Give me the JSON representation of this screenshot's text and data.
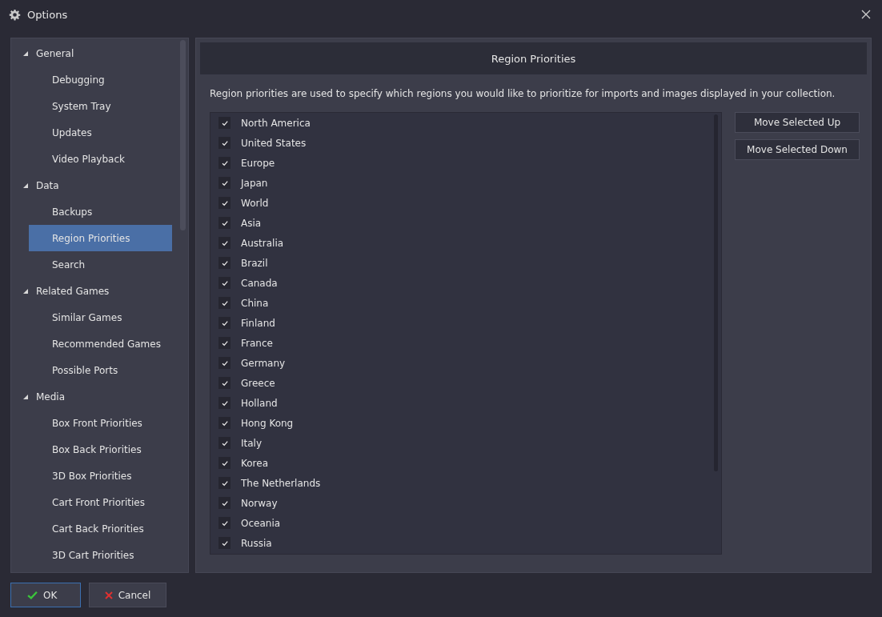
{
  "window": {
    "title": "Options"
  },
  "sidebar": {
    "items": [
      {
        "label": "General",
        "expanded": true,
        "selected": false,
        "children": [
          {
            "label": "Debugging",
            "selected": false
          },
          {
            "label": "System Tray",
            "selected": false
          },
          {
            "label": "Updates",
            "selected": false
          },
          {
            "label": "Video Playback",
            "selected": false
          }
        ]
      },
      {
        "label": "Data",
        "expanded": true,
        "selected": false,
        "children": [
          {
            "label": "Backups",
            "selected": false
          },
          {
            "label": "Region Priorities",
            "selected": true
          },
          {
            "label": "Search",
            "selected": false
          }
        ]
      },
      {
        "label": "Related Games",
        "expanded": true,
        "selected": false,
        "children": [
          {
            "label": "Similar Games",
            "selected": false
          },
          {
            "label": "Recommended Games",
            "selected": false
          },
          {
            "label": "Possible Ports",
            "selected": false
          }
        ]
      },
      {
        "label": "Media",
        "expanded": true,
        "selected": false,
        "children": [
          {
            "label": "Box Front Priorities",
            "selected": false
          },
          {
            "label": "Box Back Priorities",
            "selected": false
          },
          {
            "label": "3D Box Priorities",
            "selected": false
          },
          {
            "label": "Cart Front Priorities",
            "selected": false
          },
          {
            "label": "Cart Back Priorities",
            "selected": false
          },
          {
            "label": "3D Cart Priorities",
            "selected": false
          }
        ]
      }
    ]
  },
  "panel": {
    "title": "Region Priorities",
    "description": "Region priorities are used to specify which regions you would like to prioritize for imports and images displayed in your collection.",
    "regions": [
      {
        "label": "North America",
        "checked": true
      },
      {
        "label": "United States",
        "checked": true
      },
      {
        "label": "Europe",
        "checked": true
      },
      {
        "label": "Japan",
        "checked": true
      },
      {
        "label": "World",
        "checked": true
      },
      {
        "label": "Asia",
        "checked": true
      },
      {
        "label": "Australia",
        "checked": true
      },
      {
        "label": "Brazil",
        "checked": true
      },
      {
        "label": "Canada",
        "checked": true
      },
      {
        "label": "China",
        "checked": true
      },
      {
        "label": "Finland",
        "checked": true
      },
      {
        "label": "France",
        "checked": true
      },
      {
        "label": "Germany",
        "checked": true
      },
      {
        "label": "Greece",
        "checked": true
      },
      {
        "label": "Holland",
        "checked": true
      },
      {
        "label": "Hong Kong",
        "checked": true
      },
      {
        "label": "Italy",
        "checked": true
      },
      {
        "label": "Korea",
        "checked": true
      },
      {
        "label": "The Netherlands",
        "checked": true
      },
      {
        "label": "Norway",
        "checked": true
      },
      {
        "label": "Oceania",
        "checked": true
      },
      {
        "label": "Russia",
        "checked": true
      }
    ],
    "buttons": [
      "Move Selected Up",
      "Move Selected Down"
    ]
  },
  "footer": {
    "buttons": [
      {
        "label": "OK",
        "kind": "ok"
      },
      {
        "label": "Cancel",
        "kind": "cancel"
      }
    ]
  }
}
